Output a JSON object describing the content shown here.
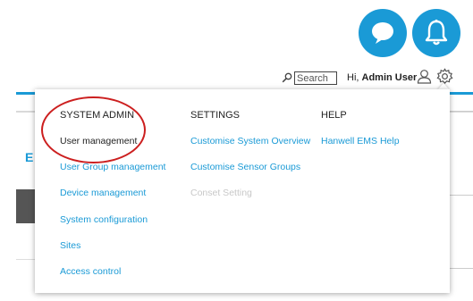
{
  "header": {
    "search_placeholder": "Search",
    "greeting_prefix": "Hi,",
    "user_name": "Admin User"
  },
  "background": {
    "partial_letter": "E"
  },
  "icons": {
    "chat": "chat-bubble-icon",
    "bell": "bell-icon",
    "search": "search-icon",
    "user": "user-icon",
    "gear": "gear-icon"
  },
  "colors": {
    "accent": "#1a9ad6",
    "annotation": "#cc1f1f",
    "disabled": "#c8c8c8"
  },
  "menu": {
    "system_admin": {
      "heading": "SYSTEM ADMIN",
      "items": [
        "User management",
        "User Group management",
        "Device management",
        "System configuration",
        "Sites",
        "Access control"
      ]
    },
    "settings": {
      "heading": "SETTINGS",
      "items": [
        "Customise System Overview",
        "Customise Sensor Groups",
        "Conset Setting"
      ]
    },
    "help": {
      "heading": "HELP",
      "items": [
        "Hanwell EMS Help"
      ]
    }
  }
}
